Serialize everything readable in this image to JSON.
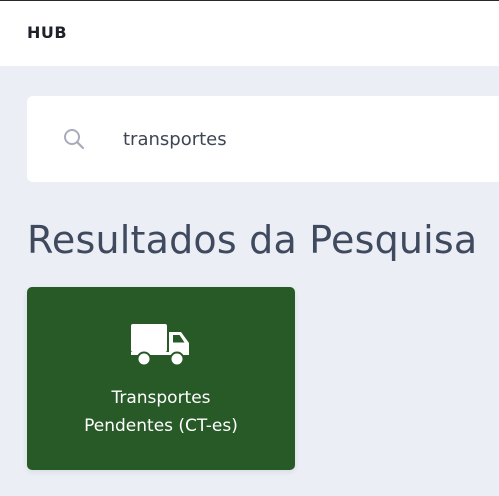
{
  "header": {
    "brand": "HUB"
  },
  "search": {
    "value": "transportes",
    "icon": "search-icon"
  },
  "main": {
    "title": "Resultados da Pesquisa",
    "results": [
      {
        "icon": "truck-icon",
        "label_line1": "Transportes",
        "label_line2": "Pendentes (CT-es)",
        "color": "#285A28"
      }
    ]
  }
}
